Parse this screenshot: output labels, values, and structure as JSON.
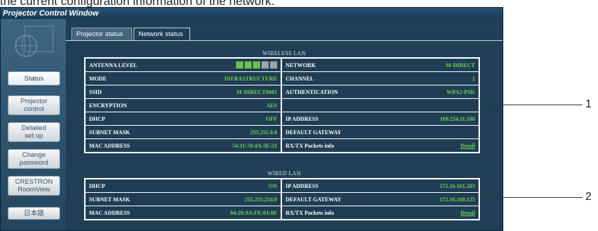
{
  "doc_text": "the current configuration information of the network.",
  "window": {
    "title": "Projector Control Window"
  },
  "nav": {
    "items": [
      {
        "label": "Status"
      },
      {
        "label": "Projector\ncontrol"
      },
      {
        "label": "Detailed\nset up"
      },
      {
        "label": "Change\npassword"
      },
      {
        "label": "CRESTRON\nRoomView"
      },
      {
        "label": "日本語"
      }
    ]
  },
  "tabs": [
    {
      "label": "Projector status"
    },
    {
      "label": "Network status"
    }
  ],
  "wireless": {
    "title": "WIRELESS LAN",
    "antenna_level": {
      "label": "ANTENNA LEVEL",
      "bars_total": 5,
      "bars_active": 3,
      "active_color": "#6cc04a",
      "inactive_color": "#9aa4aa"
    },
    "rows": [
      {
        "left_label": "",
        "left_value": "",
        "right_label": "NETWORK",
        "right_value": "M-DIRECT"
      },
      {
        "left_label": "MODE",
        "left_value": "INFRASTRUCTURE",
        "right_label": "CHANNEL",
        "right_value": "1"
      },
      {
        "left_label": "SSID",
        "left_value": "M-DIRECT0081",
        "right_label": "AUTHENTICATION",
        "right_value": "WPA2-PSK"
      },
      {
        "left_label": "ENCRYPTION",
        "left_value": "AES",
        "right_label": "",
        "right_value": ""
      },
      {
        "left_label": "DHCP",
        "left_value": "OFF",
        "right_label": "IP ADDRESS",
        "right_value": "169.254.11.100"
      },
      {
        "left_label": "SUBNET MASK",
        "left_value": "255.255.0.0",
        "right_label": "DEFAULT GATEWAY",
        "right_value": ""
      },
      {
        "left_label": "MAC ADDRESS",
        "left_value": "74:31:70:4A:3F:21",
        "right_label": "RX/TX Packets info",
        "right_value": "Detail"
      }
    ]
  },
  "wired": {
    "title": "WIRED LAN",
    "rows": [
      {
        "left_label": "DHCP",
        "left_value": "ON",
        "right_label": "IP ADDRESS",
        "right_value": "172.16.161.203"
      },
      {
        "left_label": "SUBNET MASK",
        "left_value": "255.255.254.0",
        "right_label": "DEFAULT GATEWAY",
        "right_value": "172.16.160.125"
      },
      {
        "left_label": "MAC ADDRESS",
        "left_value": "04:20:9A:FE:01:0F",
        "right_label": "RX/TX Packets info",
        "right_value": "Detail"
      }
    ]
  },
  "callouts": [
    "1",
    "2"
  ]
}
